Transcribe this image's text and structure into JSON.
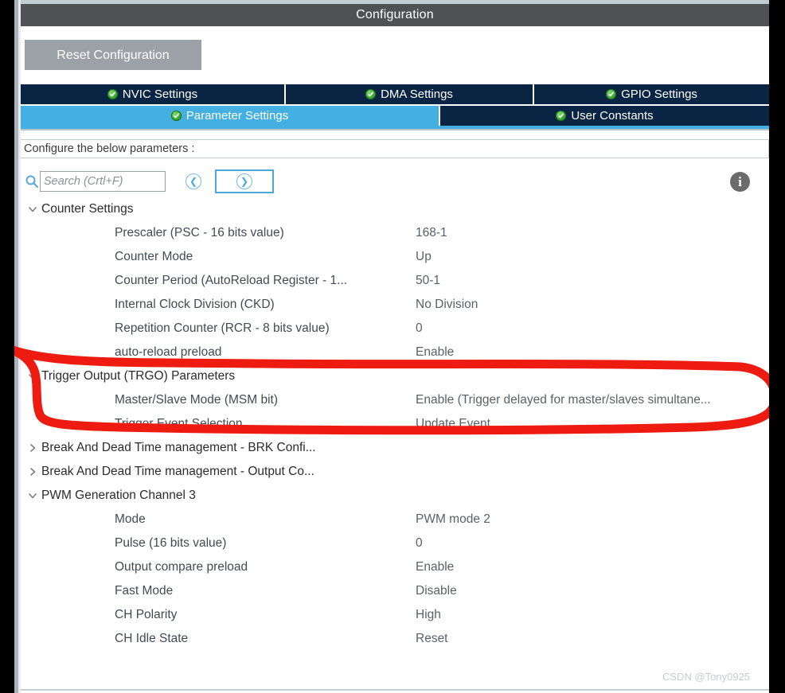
{
  "window": {
    "title": "Configuration"
  },
  "toolbar": {
    "reset_label": "Reset Configuration"
  },
  "tabs_row1": [
    {
      "label": "NVIC Settings",
      "icon": "check-circle-icon",
      "active": false
    },
    {
      "label": "DMA Settings",
      "icon": "check-circle-icon",
      "active": false
    },
    {
      "label": "GPIO Settings",
      "icon": "check-circle-icon",
      "active": false
    }
  ],
  "tabs_row2": [
    {
      "label": "Parameter Settings",
      "icon": "check-circle-icon",
      "active": true
    },
    {
      "label": "User Constants",
      "icon": "check-circle-icon",
      "active": false
    }
  ],
  "configure_bar": {
    "text": "Configure the below parameters :"
  },
  "search": {
    "placeholder": "Search (Crtl+F)",
    "value": "",
    "icon": "search-icon",
    "prev_icon": "circle-left-arrow-icon",
    "next_icon": "circle-right-arrow-icon"
  },
  "info": {
    "icon": "info-icon",
    "glyph": "i"
  },
  "groups": [
    {
      "label": "Counter Settings",
      "expanded": true,
      "chevron": "chevron-down-icon",
      "params": [
        {
          "name": "Prescaler (PSC - 16 bits value)",
          "value": "168-1"
        },
        {
          "name": "Counter Mode",
          "value": "Up"
        },
        {
          "name": "Counter Period (AutoReload Register - 1...",
          "value": "50-1"
        },
        {
          "name": "Internal Clock Division (CKD)",
          "value": "No Division"
        },
        {
          "name": "Repetition Counter (RCR - 8 bits value)",
          "value": "0"
        },
        {
          "name": "auto-reload preload",
          "value": "Enable"
        }
      ]
    },
    {
      "label": "Trigger Output (TRGO) Parameters",
      "expanded": true,
      "chevron": "chevron-down-icon",
      "params": [
        {
          "name": "Master/Slave Mode (MSM bit)",
          "value": "Enable (Trigger delayed for master/slaves simultane..."
        },
        {
          "name": "Trigger Event Selection",
          "value": "Update Event"
        }
      ]
    },
    {
      "label": "Break And Dead Time management - BRK Confi...",
      "expanded": false,
      "chevron": "chevron-right-icon",
      "params": []
    },
    {
      "label": "Break And Dead Time management - Output Co...",
      "expanded": false,
      "chevron": "chevron-right-icon",
      "params": []
    },
    {
      "label": "PWM Generation Channel 3",
      "expanded": true,
      "chevron": "chevron-down-icon",
      "params": [
        {
          "name": "Mode",
          "value": "PWM mode 2"
        },
        {
          "name": "Pulse (16 bits value)",
          "value": "0"
        },
        {
          "name": "Output compare preload",
          "value": "Enable"
        },
        {
          "name": "Fast Mode",
          "value": "Disable"
        },
        {
          "name": "CH Polarity",
          "value": "High"
        },
        {
          "name": "CH Idle State",
          "value": "Reset"
        }
      ]
    }
  ],
  "annotation": {
    "type": "hand-drawn-oval",
    "color": "#ee1b11"
  },
  "watermark": {
    "text": "CSDN @Tony0925"
  },
  "colors": {
    "title_bar": "#4e5253",
    "tab_inactive": "#0a2444",
    "tab_active": "#44b0e2",
    "reset_button": "#9ba1a6",
    "accent_blue": "#4aa8dd",
    "annotation_red": "#ee1b11"
  }
}
